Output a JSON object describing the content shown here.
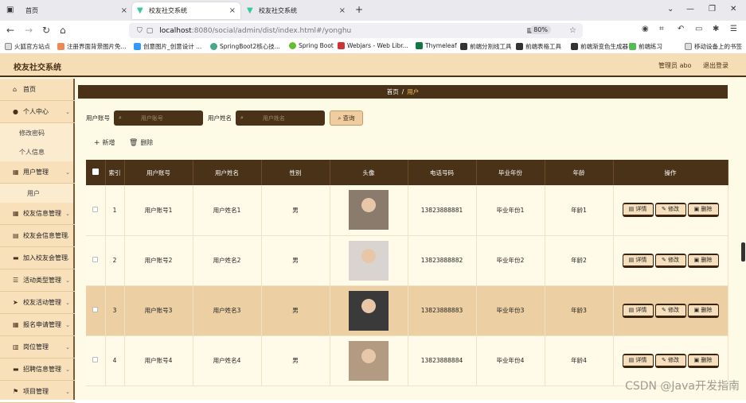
{
  "browser": {
    "tabs": [
      {
        "label": "首页"
      },
      {
        "label": "校友社交系统"
      },
      {
        "label": "校友社交系统"
      }
    ],
    "url_host": "localhost",
    "url_path": ":8080/social/admin/dist/index.html#/yonghu",
    "zoom": "80%",
    "bookmarks": [
      {
        "label": "火狐官方站点"
      },
      {
        "label": "注册界面背景图片免..."
      },
      {
        "label": "创意图片_创意设计 ..."
      },
      {
        "label": "SpringBoot2核心技..."
      },
      {
        "label": "Spring Boot"
      },
      {
        "label": "Webjars - Web Libr..."
      },
      {
        "label": "Thymeleaf"
      },
      {
        "label": "前端分割线工具"
      },
      {
        "label": "前端表格工具"
      },
      {
        "label": "前端渐变色生成器"
      },
      {
        "label": "前端练习"
      },
      {
        "label": "移动设备上的书签"
      }
    ]
  },
  "app": {
    "title": "校友社交系统",
    "admin_label": "管理员 abo",
    "logout_label": "退出登录"
  },
  "sidebar": {
    "items": [
      {
        "label": "首页",
        "icon": "home-icon",
        "glyph": "⌂"
      },
      {
        "label": "个人中心",
        "icon": "user-icon",
        "glyph": "●"
      },
      {
        "label": "修改密码"
      },
      {
        "label": "个人信息"
      },
      {
        "label": "用户管理",
        "icon": "grid-icon",
        "glyph": "▦"
      },
      {
        "label": "用户"
      },
      {
        "label": "校友信息管理",
        "icon": "list-icon",
        "glyph": "▦"
      },
      {
        "label": "校友会信息管理",
        "icon": "bank-icon",
        "glyph": "▤"
      },
      {
        "label": "加入校友会管理",
        "icon": "chat-icon",
        "glyph": "▬"
      },
      {
        "label": "活动类型管理",
        "icon": "sliders-icon",
        "glyph": "☰"
      },
      {
        "label": "校友活动管理",
        "icon": "send-icon",
        "glyph": "➤"
      },
      {
        "label": "报名申请管理",
        "icon": "grid-icon",
        "glyph": "▦"
      },
      {
        "label": "岗位管理",
        "icon": "folder-icon",
        "glyph": "▥"
      },
      {
        "label": "招聘信息管理",
        "icon": "chat-icon",
        "glyph": "▬"
      },
      {
        "label": "项目管理",
        "icon": "flag-icon",
        "glyph": "⚑"
      }
    ]
  },
  "breadcrumb": {
    "home": "首页",
    "sep": "/",
    "current": "用户"
  },
  "search": {
    "account_label": "用户账号",
    "account_placeholder": "用户账号",
    "name_label": "用户姓名",
    "name_placeholder": "用户姓名",
    "query_label": "查询"
  },
  "actions": {
    "add_label": "新增",
    "delete_label": "删除"
  },
  "table": {
    "headers": [
      "索引",
      "用户账号",
      "用户姓名",
      "性别",
      "头像",
      "电话号码",
      "毕业年份",
      "年龄",
      "操作"
    ],
    "rows": [
      {
        "index": "1",
        "account": "用户账号1",
        "name": "用户姓名1",
        "gender": "男",
        "phone": "13823888881",
        "year": "毕业年份1",
        "age": "年龄1",
        "avatar_bg": "#8a7b6d"
      },
      {
        "index": "2",
        "account": "用户账号2",
        "name": "用户姓名2",
        "gender": "男",
        "phone": "13823888882",
        "year": "毕业年份2",
        "age": "年龄2",
        "avatar_bg": "#d9d4cf"
      },
      {
        "index": "3",
        "account": "用户账号3",
        "name": "用户姓名3",
        "gender": "男",
        "phone": "13823888883",
        "year": "毕业年份3",
        "age": "年龄3",
        "avatar_bg": "#3a3a3a"
      },
      {
        "index": "4",
        "account": "用户账号4",
        "name": "用户姓名4",
        "gender": "男",
        "phone": "13823888884",
        "year": "毕业年份4",
        "age": "年龄4",
        "avatar_bg": "#b39a82"
      }
    ],
    "op_detail": "详情",
    "op_edit": "修改",
    "op_delete": "删除"
  },
  "watermark": "CSDN @Java开发指南"
}
